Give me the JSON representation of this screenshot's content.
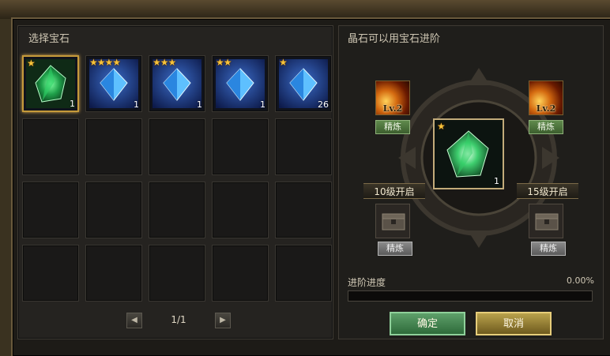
{
  "left_panel": {
    "title": "选择宝石",
    "slots": [
      {
        "type": "green-gem",
        "stars": "★",
        "count": "1",
        "selected": true
      },
      {
        "type": "blue-gem",
        "stars": "★★★★",
        "count": "1"
      },
      {
        "type": "blue-gem",
        "stars": "★★★",
        "count": "1"
      },
      {
        "type": "blue-gem",
        "stars": "★★",
        "count": "1"
      },
      {
        "type": "blue-gem",
        "stars": "★",
        "count": "26"
      }
    ],
    "pager": {
      "prev_icon": "◀",
      "next_icon": "▶",
      "page": "1/1"
    }
  },
  "right_panel": {
    "title": "晶石可以用宝石进阶",
    "skill_left": {
      "level": "Lv.2",
      "tag": "精炼"
    },
    "skill_right": {
      "level": "Lv.2",
      "tag": "精炼"
    },
    "lock_left": {
      "label": "10级开启",
      "tag": "精炼"
    },
    "lock_right": {
      "label": "15级开启",
      "tag": "精炼"
    },
    "main_gem": {
      "stars": "★",
      "count": "1"
    },
    "progress": {
      "label": "进阶进度",
      "value_text": "0.00%",
      "fraction": 0.0
    },
    "buttons": {
      "ok": "确定",
      "cancel": "取消"
    }
  },
  "colors": {
    "accent_gold": "#c59a3a",
    "ok_green": "#2e6a3a",
    "cancel_gold": "#b9a24c"
  }
}
